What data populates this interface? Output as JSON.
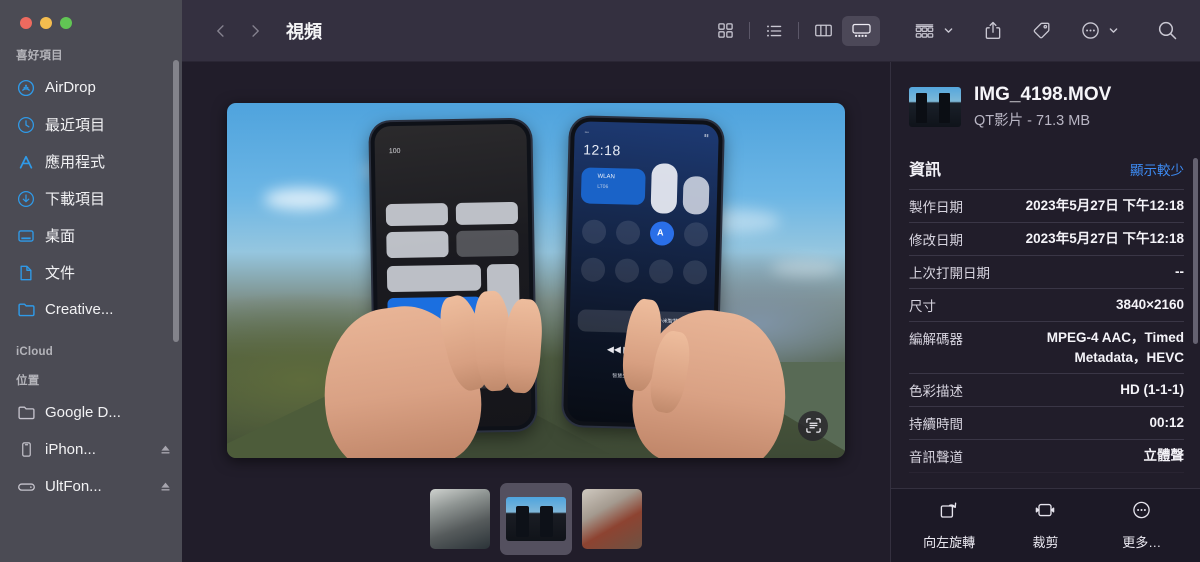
{
  "window": {
    "traffic_lights": [
      {
        "name": "close",
        "color": "#ed6a5f"
      },
      {
        "name": "minimize",
        "color": "#f4bd4f"
      },
      {
        "name": "zoom",
        "color": "#61c554"
      }
    ]
  },
  "sidebar": {
    "sections": [
      {
        "title": "喜好項目",
        "items": [
          {
            "label": "AirDrop",
            "icon": "airdrop-icon",
            "eject": false
          },
          {
            "label": "最近項目",
            "icon": "recents-clock-icon",
            "eject": false
          },
          {
            "label": "應用程式",
            "icon": "applications-icon",
            "eject": false
          },
          {
            "label": "下載項目",
            "icon": "downloads-icon",
            "eject": false
          },
          {
            "label": "桌面",
            "icon": "desktop-icon",
            "eject": false
          },
          {
            "label": "文件",
            "icon": "documents-icon",
            "eject": false
          },
          {
            "label": "Creative...",
            "icon": "folder-icon",
            "eject": false
          }
        ]
      },
      {
        "title": "iCloud",
        "items": []
      },
      {
        "title": "位置",
        "items": [
          {
            "label": "Google D...",
            "icon": "folder-icon",
            "eject": false
          },
          {
            "label": "iPhon...",
            "icon": "iphone-icon",
            "eject": true
          },
          {
            "label": "UltFon...",
            "icon": "external-drive-icon",
            "eject": true
          }
        ]
      }
    ]
  },
  "toolbar": {
    "back_label": "上一步",
    "forward_label": "下一步",
    "title": "視頻",
    "view_modes": [
      {
        "name": "icon-view",
        "icon": "grid-icon",
        "active": false
      },
      {
        "name": "list-view",
        "icon": "list-icon",
        "active": false
      },
      {
        "name": "column-view",
        "icon": "columns-icon",
        "active": false
      },
      {
        "name": "gallery-view",
        "icon": "gallery-icon",
        "active": true
      }
    ],
    "group_button": "group-icon",
    "share_button": "share-icon",
    "tag_button": "tag-icon",
    "more_button": "more-circle-icon",
    "search_button": "search-icon"
  },
  "preview": {
    "live_text_button": "live-text-icon",
    "filmstrip": [
      {
        "name": "thumbnail-1",
        "selected": false
      },
      {
        "name": "thumbnail-2",
        "selected": true
      },
      {
        "name": "thumbnail-3",
        "selected": false
      }
    ],
    "phone_left": {
      "battery": "100",
      "screen": "control-center"
    },
    "phone_right": {
      "clock": "12:18",
      "wifi_label": "WLAN",
      "wifi_sub": "LT06",
      "auto_badge": "A",
      "media_label": "小米智慧中心",
      "bottom_label": "智慧生活"
    }
  },
  "info_panel": {
    "file_name": "IMG_4198.MOV",
    "file_subtitle": "QT影片 - 71.3 MB",
    "section_title": "資訊",
    "section_link": "顯示較少",
    "rows": [
      {
        "key": "製作日期",
        "value": "2023年5月27日 下午12:18"
      },
      {
        "key": "修改日期",
        "value": "2023年5月27日 下午12:18"
      },
      {
        "key": "上次打開日期",
        "value": "--"
      },
      {
        "key": "尺寸",
        "value": "3840×2160"
      },
      {
        "key": "編解碼器",
        "value": "MPEG-4 AAC，Timed Metadata，HEVC"
      },
      {
        "key": "色彩描述",
        "value": "HD (1-1-1)"
      },
      {
        "key": "持續時間",
        "value": "00:12"
      },
      {
        "key": "音訊聲道",
        "value": "立體聲"
      }
    ],
    "actions": [
      {
        "label": "向左旋轉",
        "icon": "rotate-left-icon"
      },
      {
        "label": "裁剪",
        "icon": "trim-icon"
      },
      {
        "label": "更多…",
        "icon": "more-circle-icon"
      }
    ]
  },
  "colors": {
    "sidebar_bg": "#4b4b54",
    "toolbar_bg": "#343040",
    "preview_bg": "#211d2a",
    "info_bg": "#211d2a",
    "accent_blue": "#3d8cf5",
    "sidebar_icon_blue": "#2f9ae8"
  }
}
